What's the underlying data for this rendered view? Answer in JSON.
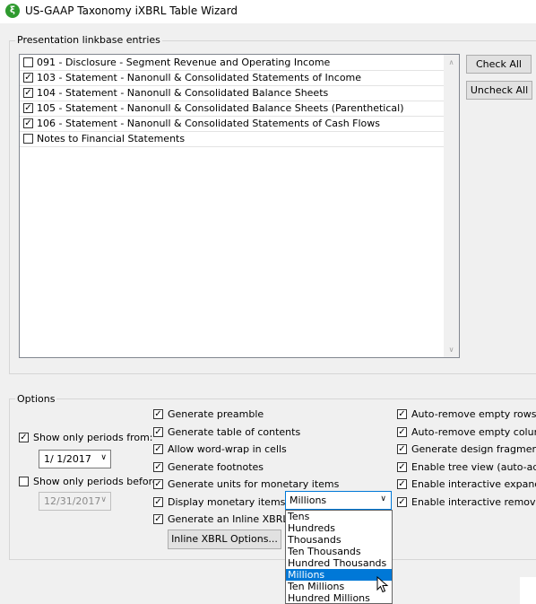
{
  "window": {
    "title": "US-GAAP Taxonomy iXBRL Table Wizard",
    "icon_name": "ixbrl-app-icon",
    "icon_glyph": "ξ"
  },
  "presentation": {
    "label": "Presentation linkbase entries",
    "entries": [
      {
        "label": "091 - Disclosure - Segment Revenue and Operating Income",
        "checked": false
      },
      {
        "label": "103 - Statement - Nanonull & Consolidated Statements of Income",
        "checked": true
      },
      {
        "label": "104 - Statement - Nanonull & Consolidated Balance Sheets",
        "checked": true
      },
      {
        "label": "105 - Statement - Nanonull & Consolidated Balance Sheets (Parenthetical)",
        "checked": true
      },
      {
        "label": "106 - Statement - Nanonull & Consolidated Statements of Cash Flows",
        "checked": true
      },
      {
        "label": "Notes to Financial Statements",
        "checked": false
      }
    ],
    "check_all_label": "Check All",
    "uncheck_all_label": "Uncheck All"
  },
  "options": {
    "label": "Options",
    "periods_from_label": "Show only periods from:",
    "periods_from_checked": true,
    "periods_from_value": "1/ 1/2017",
    "periods_before_label": "Show only periods before:",
    "periods_before_checked": false,
    "periods_before_value": "12/31/2017",
    "col2": [
      {
        "label": "Generate preamble",
        "checked": true
      },
      {
        "label": "Generate table of contents",
        "checked": true
      },
      {
        "label": "Allow word-wrap in cells",
        "checked": true
      },
      {
        "label": "Generate footnotes",
        "checked": true
      },
      {
        "label": "Generate units for monetary items",
        "checked": true
      },
      {
        "label": "Display monetary items in:",
        "checked": true
      },
      {
        "label": "Generate an Inline XBRL Do",
        "checked": true
      }
    ],
    "inline_options_label": "Inline XBRL Options...",
    "col3": [
      {
        "label": "Auto-remove empty rows",
        "checked": true
      },
      {
        "label": "Auto-remove empty columns",
        "checked": true
      },
      {
        "label": "Generate design fragments fo",
        "checked": true
      },
      {
        "label": "Enable tree view (auto-add in",
        "checked": true
      },
      {
        "label": "Enable interactive expand/co",
        "checked": true
      },
      {
        "label": "Enable interactive removal of",
        "checked": true
      }
    ],
    "units_value": "Millions",
    "units_options": [
      "Tens",
      "Hundreds",
      "Thousands",
      "Ten Thousands",
      "Hundred Thousands",
      "Millions",
      "Ten Millions",
      "Hundred Millions"
    ],
    "units_selected_index": 5
  },
  "glyphs": {
    "check": "✓",
    "dropdown": "∨",
    "up_arrow": "∧",
    "down_arrow": "∨"
  }
}
